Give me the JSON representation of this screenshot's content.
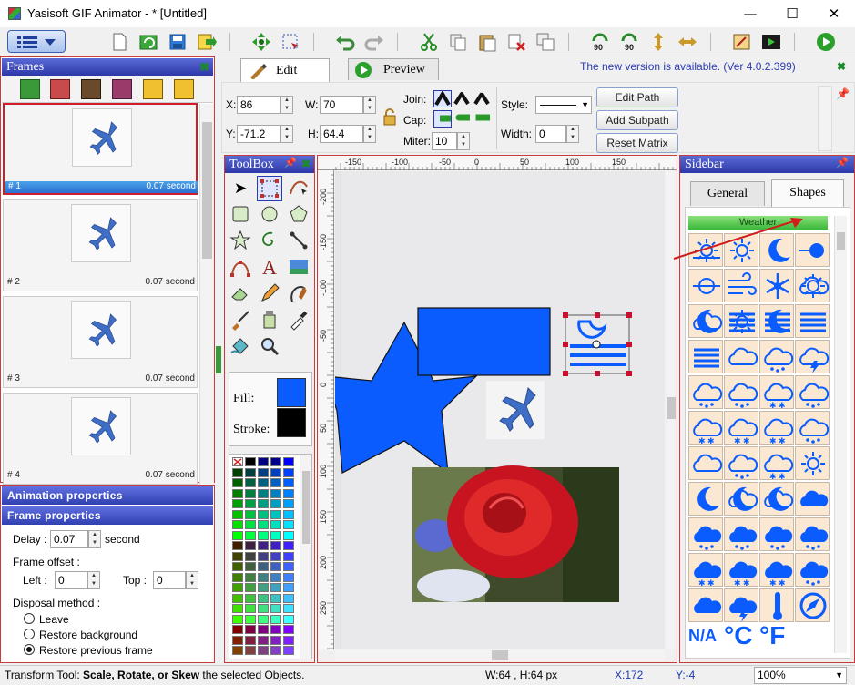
{
  "window": {
    "title": "Yasisoft GIF Animator - * [Untitled]",
    "minimize": "—",
    "maximize": "☐",
    "close": "✕"
  },
  "frames_panel": {
    "title": "Frames",
    "frames": [
      {
        "index": "# 1",
        "duration": "0.07 second"
      },
      {
        "index": "# 2",
        "duration": "0.07 second"
      },
      {
        "index": "# 3",
        "duration": "0.07 second"
      },
      {
        "index": "# 4",
        "duration": "0.07 second"
      }
    ]
  },
  "properties": {
    "animation_header": "Animation properties",
    "frame_header": "Frame properties",
    "delay_label": "Delay :",
    "delay_value": "0.07",
    "delay_unit": "second",
    "offset_label": "Frame offset :",
    "left_label": "Left :",
    "left_value": "0",
    "top_label": "Top :",
    "top_value": "0",
    "disposal_label": "Disposal method :",
    "disposal_options": [
      "Leave",
      "Restore background",
      "Restore previous frame"
    ],
    "disposal_selected": "Restore previous frame"
  },
  "tabs": {
    "edit": "Edit",
    "preview": "Preview"
  },
  "update_notice": "The new version is available. (Ver 4.0.2.399)",
  "edit_bar": {
    "x_label": "X:",
    "x_value": "86",
    "y_label": "Y:",
    "y_value": "-71.2",
    "w_label": "W:",
    "w_value": "70",
    "h_label": "H:",
    "h_value": "64.4",
    "join_label": "Join:",
    "cap_label": "Cap:",
    "miter_label": "Miter:",
    "miter_value": "10",
    "style_label": "Style:",
    "width_label": "Width:",
    "width_value": "0",
    "edit_path": "Edit Path",
    "add_subpath": "Add Subpath",
    "reset_matrix": "Reset Matrix"
  },
  "toolbox": {
    "title": "ToolBox",
    "fill_label": "Fill:",
    "stroke_label": "Stroke:",
    "fill_color": "#0a5cff",
    "stroke_color": "#000000"
  },
  "ruler": {
    "h_ticks": [
      "-150",
      "-100",
      "-50",
      "0",
      "50",
      "100",
      "150"
    ],
    "v_ticks": [
      "-200",
      "-150",
      "-100",
      "-50",
      "0",
      "50",
      "100",
      "150",
      "200",
      "250"
    ]
  },
  "sidebar": {
    "title": "Sidebar",
    "tab_general": "General",
    "tab_shapes": "Shapes",
    "category": "Weather",
    "na_label": "N/A",
    "celsius": "°C",
    "fahrenheit": "°F"
  },
  "status": {
    "tool_prefix": "Transform Tool: ",
    "tool_bold": "Scale, Rotate, or Skew",
    "tool_suffix": " the selected Objects.",
    "size": "W:64 , H:64 px",
    "x": "X:172",
    "y": "Y:-4",
    "zoom": "100%"
  },
  "colors": {
    "accent_blue": "#0a5cff",
    "panel_header": "#2d38a8",
    "selection_red": "#d11c2a"
  }
}
